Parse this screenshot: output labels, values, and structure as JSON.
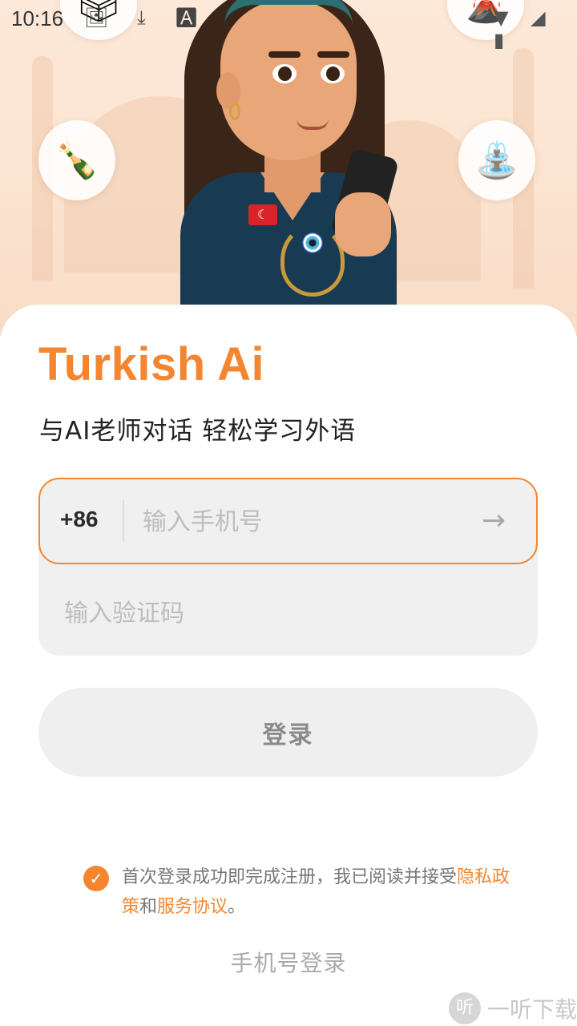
{
  "status_bar": {
    "time": "10:16",
    "left_icons": "🖼 ⤓ 🅰",
    "right_icons": "▼ ◢ ▮"
  },
  "hero": {
    "bubbles": [
      "🍾",
      "⛲",
      "🗳",
      "🌋"
    ],
    "flag_glyph": "☾"
  },
  "app": {
    "title": "Turkish Ai",
    "subtitle": "与AI老师对话 轻松学习外语"
  },
  "form": {
    "country_code": "+86",
    "phone_placeholder": "输入手机号",
    "phone_value": "",
    "code_placeholder": "输入验证码",
    "code_value": "",
    "submit_arrow": "→",
    "login_button": "登录"
  },
  "agreement": {
    "checked": true,
    "check_glyph": "✓",
    "text_before": "首次登录成功即完成注册，我已阅读并接受",
    "privacy_link": "隐私政策",
    "and": "和",
    "service_link": "服务协议",
    "end": "。"
  },
  "alt_login": "手机号登录",
  "watermark": {
    "logo": "听",
    "text": "一听下载"
  },
  "colors": {
    "accent": "#f5862f",
    "input_bg": "#f0f0f0",
    "hero_bg": "#fde9d9"
  }
}
